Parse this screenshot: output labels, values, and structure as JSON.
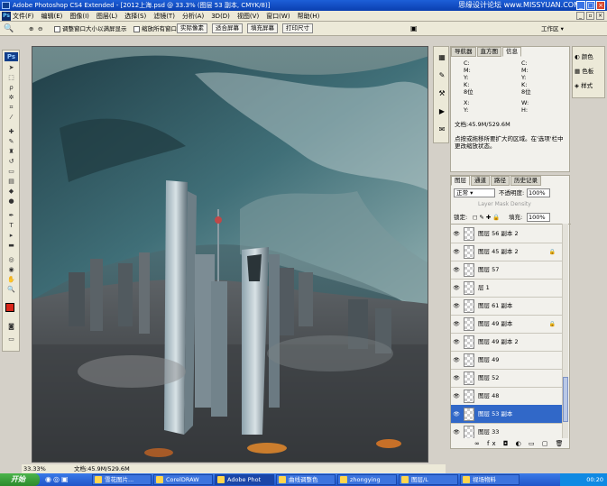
{
  "titlebar": {
    "title": "Adobe Photoshop CS4 Extended - [2012上海.psd @ 33.3% (图层 53 副本, CMYK/8)]",
    "watermark": "思缘设计论坛 www.MISSYUAN.COM"
  },
  "menubar": {
    "items": [
      "文件(F)",
      "编辑(E)",
      "图像(I)",
      "图层(L)",
      "选择(S)",
      "滤镜(T)",
      "分析(A)",
      "3D(D)",
      "视图(V)",
      "窗口(W)",
      "帮助(H)"
    ],
    "workspace": "工作区"
  },
  "optionsbar": {
    "resize_windows": "调整窗口大小以满屏显示",
    "zoom_all": "缩放所有窗口",
    "actual_pixels": "实际像素",
    "fit_screen": "适合屏幕",
    "fill_screen": "填充屏幕",
    "print_size": "打印尺寸"
  },
  "info_panel": {
    "tabs": [
      "导航器",
      "直方图",
      "信息"
    ],
    "cmyk_left": "C:\nM:\nY:\nK:\n8位",
    "cmyk_right": "C:\nM:\nY:\nK:\n8位",
    "xy": "X:\nY:",
    "wh": "W:\nH:",
    "doc": "文档:45.9M/529.6M",
    "hint": "点按或拖移所要扩大的区域。在'选项'栏中\n更改缩放状态。"
  },
  "swatch_dock": {
    "items": [
      "颜色",
      "色板",
      "样式"
    ]
  },
  "layers_panel": {
    "tabs": [
      "图层",
      "通道",
      "路径",
      "历史记录"
    ],
    "blend_mode": "正常",
    "opacity_label": "不透明度:",
    "opacity": "100%",
    "layer_mask_density": "Layer Mask Density",
    "lock_label": "锁定:",
    "fill_label": "填充:",
    "fill": "100%",
    "layers": [
      {
        "name": "图层 56 副本 2",
        "locked": false,
        "selected": false
      },
      {
        "name": "图层 45 副本 2",
        "locked": true,
        "selected": false
      },
      {
        "name": "图层 57",
        "locked": false,
        "selected": false
      },
      {
        "name": "层 1",
        "locked": false,
        "selected": false
      },
      {
        "name": "图层 61 副本",
        "locked": false,
        "selected": false
      },
      {
        "name": "图层 49 副本",
        "locked": true,
        "selected": false
      },
      {
        "name": "图层 49 副本 2",
        "locked": false,
        "selected": false
      },
      {
        "name": "图层 49",
        "locked": false,
        "selected": false
      },
      {
        "name": "图层 52",
        "locked": false,
        "selected": false
      },
      {
        "name": "图层 48",
        "locked": false,
        "selected": false
      },
      {
        "name": "图层 53 副本",
        "locked": false,
        "selected": true
      },
      {
        "name": "图层 33",
        "locked": false,
        "selected": false
      }
    ]
  },
  "status": {
    "zoom": "33.33%",
    "doc": "文档:45.9M/529.6M"
  },
  "taskbar": {
    "start": "开始",
    "tasks": [
      "雪花图片...",
      "CorelDRAW",
      "Adobe Phot",
      "曲线调整色",
      "zhongying",
      "图层/L",
      "视场物料"
    ],
    "active_index": 2,
    "time": "00:20"
  },
  "colors": {
    "title_blue": "#0a3fb0",
    "selection_blue": "#3168c8",
    "foreground": "#d9271a",
    "background": "#ffffff"
  }
}
